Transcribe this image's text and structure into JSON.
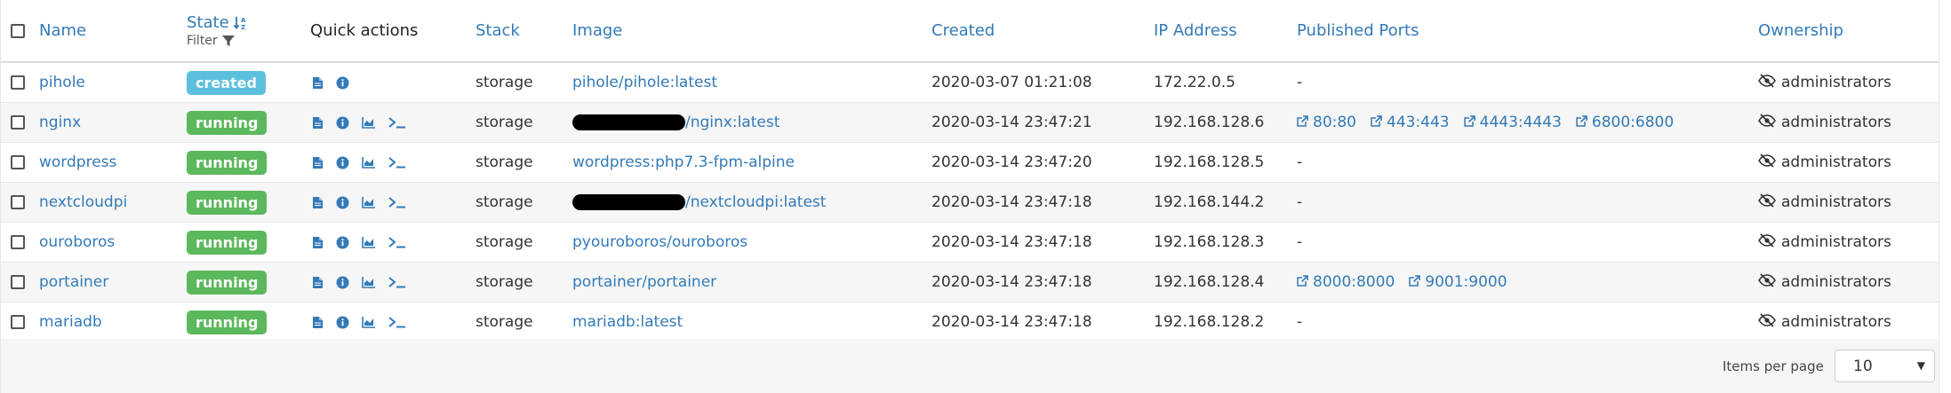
{
  "header": {
    "name": "Name",
    "state": "State",
    "sort_glyph": "↓↕",
    "filter": "Filter",
    "quick_actions": "Quick actions",
    "stack": "Stack",
    "image": "Image",
    "created": "Created",
    "ip_address": "IP Address",
    "published_ports": "Published Ports",
    "ownership": "Ownership"
  },
  "rows": [
    {
      "name": "pihole",
      "state": "created",
      "stack": "storage",
      "image_prefix": "",
      "image": "pihole/pihole:latest",
      "created": "2020-03-07 01:21:08",
      "ip": "172.22.0.5",
      "ports": [],
      "no_ports": "-",
      "owner": "administrators"
    },
    {
      "name": "nginx",
      "state": "running",
      "stack": "storage",
      "image_prefix": "redacted",
      "image": "/nginx:latest",
      "created": "2020-03-14 23:47:21",
      "ip": "192.168.128.6",
      "ports": [
        "80:80",
        "443:443",
        "4443:4443",
        "6800:6800"
      ],
      "no_ports": "",
      "owner": "administrators"
    },
    {
      "name": "wordpress",
      "state": "running",
      "stack": "storage",
      "image_prefix": "",
      "image": "wordpress:php7.3-fpm-alpine",
      "created": "2020-03-14 23:47:20",
      "ip": "192.168.128.5",
      "ports": [],
      "no_ports": "-",
      "owner": "administrators"
    },
    {
      "name": "nextcloudpi",
      "state": "running",
      "stack": "storage",
      "image_prefix": "redacted",
      "image": "/nextcloudpi:latest",
      "created": "2020-03-14 23:47:18",
      "ip": "192.168.144.2",
      "ports": [],
      "no_ports": "-",
      "owner": "administrators"
    },
    {
      "name": "ouroboros",
      "state": "running",
      "stack": "storage",
      "image_prefix": "",
      "image": "pyouroboros/ouroboros",
      "created": "2020-03-14 23:47:18",
      "ip": "192.168.128.3",
      "ports": [],
      "no_ports": "-",
      "owner": "administrators"
    },
    {
      "name": "portainer",
      "state": "running",
      "stack": "storage",
      "image_prefix": "",
      "image": "portainer/portainer",
      "created": "2020-03-14 23:47:18",
      "ip": "192.168.128.4",
      "ports": [
        "8000:8000",
        "9001:9000"
      ],
      "no_ports": "",
      "owner": "administrators"
    },
    {
      "name": "mariadb",
      "state": "running",
      "stack": "storage",
      "image_prefix": "",
      "image": "mariadb:latest",
      "created": "2020-03-14 23:47:18",
      "ip": "192.168.128.2",
      "ports": [],
      "no_ports": "-",
      "owner": "administrators"
    }
  ],
  "footer": {
    "items_per_page_label": "Items per page",
    "items_per_page_value": "10"
  },
  "colors": {
    "link": "#337ab7",
    "created_badge": "#5bc0de",
    "running_badge": "#5cb85c"
  },
  "icons": {
    "logs": "file-icon",
    "inspect": "info-icon",
    "stats": "chart-icon",
    "console": "terminal-icon",
    "port_link": "external-link-icon",
    "ownership": "eye-slash-icon",
    "filter": "filter-icon",
    "sort": "sort-icon"
  }
}
